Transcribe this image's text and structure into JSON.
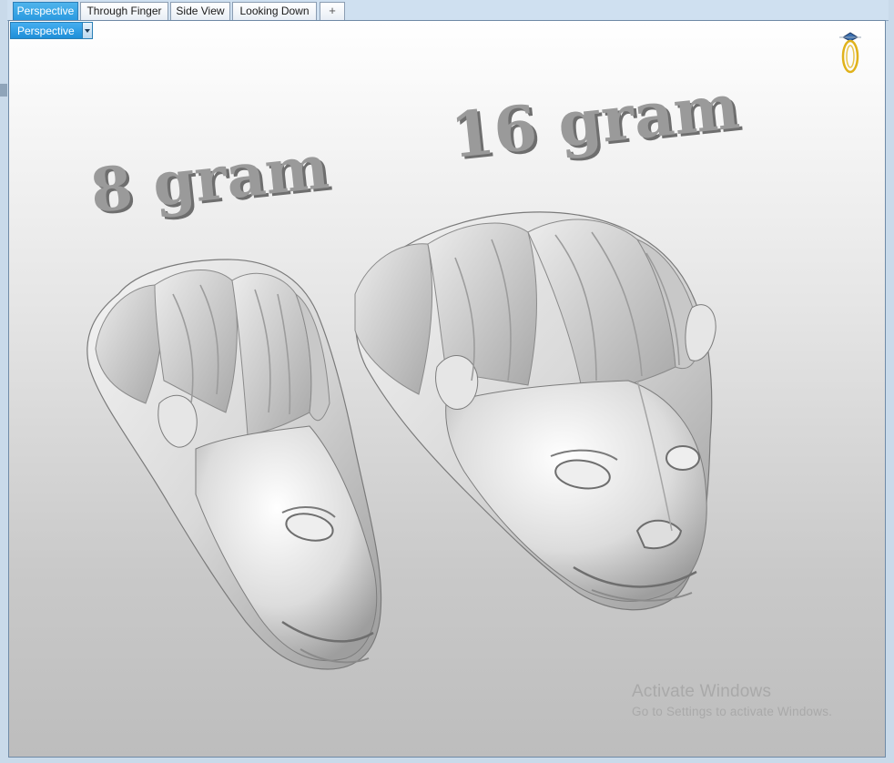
{
  "tabs": [
    {
      "label": "Perspective",
      "active": true
    },
    {
      "label": "Through Finger",
      "active": false
    },
    {
      "label": "Side View",
      "active": false
    },
    {
      "label": "Looking Down",
      "active": false
    }
  ],
  "tab_add_glyph": "+",
  "viewport": {
    "dropdown_label": "Perspective",
    "scene_labels": {
      "left": "8 gram",
      "right": "16 gram"
    },
    "widget_icon": "ring-widget-icon"
  },
  "watermark": {
    "line1": "Activate Windows",
    "line2": "Go to Settings to activate Windows."
  },
  "colors": {
    "active_tab": "#2a9ae0",
    "viewport_top": "#ffffff",
    "viewport_bottom": "#bdbdbd",
    "model_gray": "#cfcfcf",
    "text_3d": "#8c8c8c"
  }
}
